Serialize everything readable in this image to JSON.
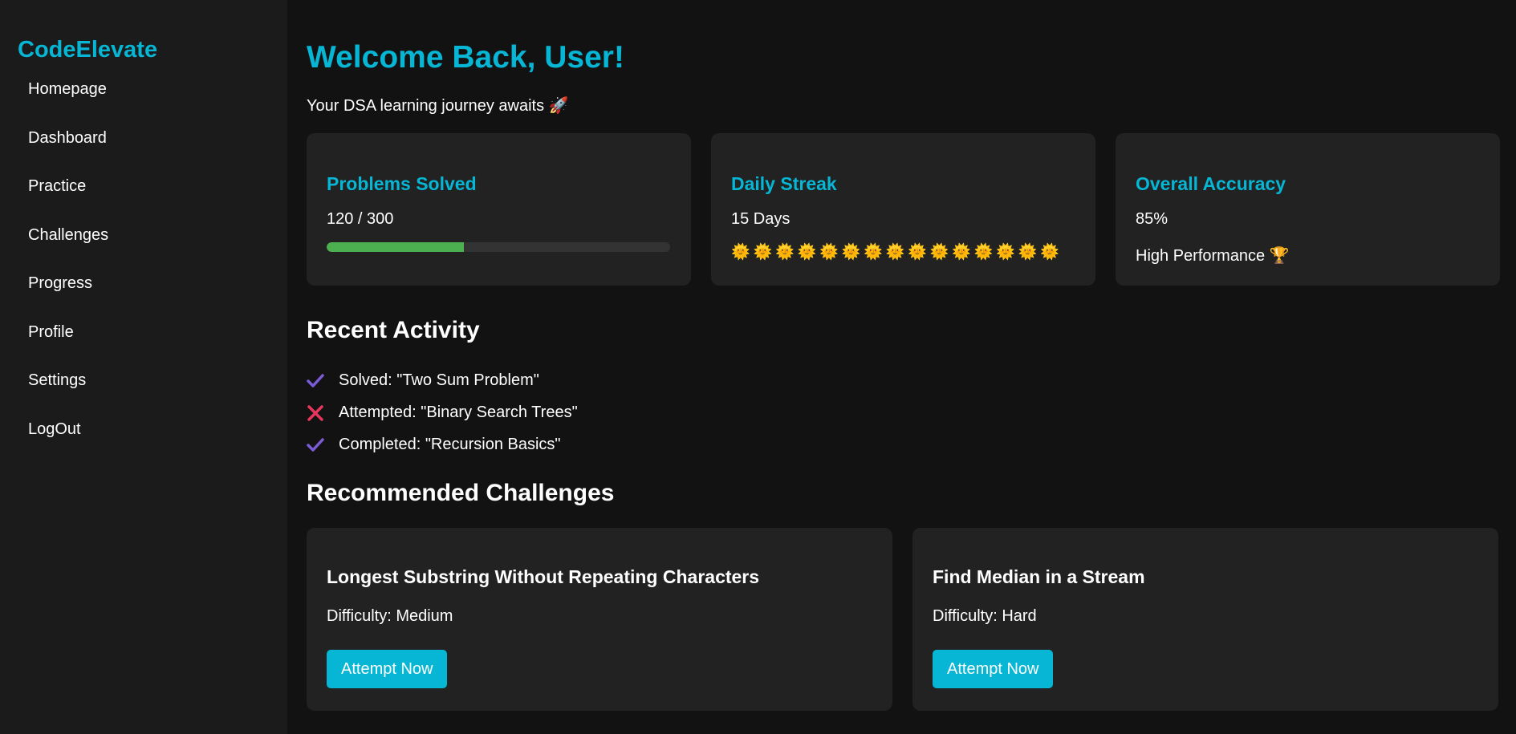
{
  "sidebar": {
    "brand": "CodeElevate",
    "items": [
      {
        "label": "Homepage"
      },
      {
        "label": "Dashboard"
      },
      {
        "label": "Practice"
      },
      {
        "label": "Challenges"
      },
      {
        "label": "Progress"
      },
      {
        "label": "Profile"
      },
      {
        "label": "Settings"
      },
      {
        "label": "LogOut"
      }
    ]
  },
  "header": {
    "title": "Welcome Back, User!",
    "subtitle": "Your DSA learning journey awaits 🚀"
  },
  "stats": {
    "problems": {
      "title": "Problems Solved",
      "value": "120 / 300",
      "progress_fraction": 0.4,
      "bar_color": "#4caf50"
    },
    "streak": {
      "title": "Daily Streak",
      "value": "15 Days",
      "sun_glyph": "🌞",
      "sun_count": 15
    },
    "accuracy": {
      "title": "Overall Accuracy",
      "value": "85%",
      "note": "High Performance 🏆"
    }
  },
  "activity": {
    "title": "Recent Activity",
    "items": [
      {
        "icon": "check-icon",
        "text": "Solved: \"Two Sum Problem\""
      },
      {
        "icon": "cross-icon",
        "text": "Attempted: \"Binary Search Trees\""
      },
      {
        "icon": "check-icon",
        "text": "Completed: \"Recursion Basics\""
      }
    ]
  },
  "recommended": {
    "title": "Recommended Challenges",
    "cards": [
      {
        "name": "Longest Substring Without Repeating Characters",
        "difficulty": "Difficulty: Medium",
        "button": "Attempt Now"
      },
      {
        "name": "Find Median in a Stream",
        "difficulty": "Difficulty: Hard",
        "button": "Attempt Now"
      }
    ]
  },
  "colors": {
    "accent": "#06b6d4",
    "check": "#7c5cd6",
    "cross": "#e8365d",
    "background": "#121212",
    "sidebar": "#1b1b1b",
    "card": "#222222"
  }
}
